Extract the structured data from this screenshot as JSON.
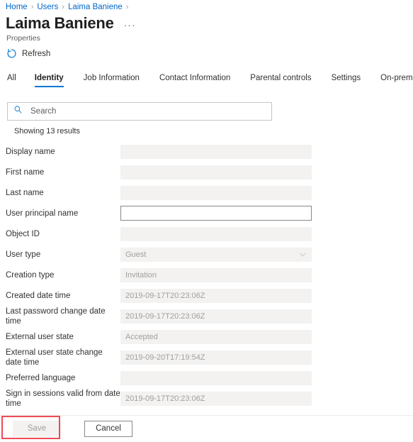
{
  "breadcrumb": {
    "items": [
      {
        "label": "Home"
      },
      {
        "label": "Users"
      },
      {
        "label": "Laima Baniene"
      }
    ],
    "separator": "›"
  },
  "header": {
    "title": "Laima Baniene",
    "subtitle": "Properties",
    "overflow_menu": "···"
  },
  "commandbar": {
    "refresh_label": "Refresh",
    "refresh_icon": "refresh-icon"
  },
  "tabs": [
    {
      "label": "All",
      "active": false
    },
    {
      "label": "Identity",
      "active": true
    },
    {
      "label": "Job Information",
      "active": false
    },
    {
      "label": "Contact Information",
      "active": false
    },
    {
      "label": "Parental controls",
      "active": false
    },
    {
      "label": "Settings",
      "active": false
    },
    {
      "label": "On-premises",
      "active": false
    }
  ],
  "search": {
    "placeholder": "Search",
    "value": "",
    "icon": "search-icon"
  },
  "results": {
    "count_text": "Showing 13 results"
  },
  "fields": [
    {
      "label": "Display name",
      "value": "",
      "state": "disabled",
      "type": "text"
    },
    {
      "label": "First name",
      "value": "",
      "state": "disabled",
      "type": "text"
    },
    {
      "label": "Last name",
      "value": "",
      "state": "disabled",
      "type": "text"
    },
    {
      "label": "User principal name",
      "value": "",
      "state": "editable",
      "type": "text"
    },
    {
      "label": "Object ID",
      "value": "",
      "state": "disabled",
      "type": "text",
      "redacted": true
    },
    {
      "label": "User type",
      "value": "Guest",
      "state": "disabled",
      "type": "select"
    },
    {
      "label": "Creation type",
      "value": "Invitation",
      "state": "disabled",
      "type": "text"
    },
    {
      "label": "Created date time",
      "value": "2019-09-17T20:23:06Z",
      "state": "disabled",
      "type": "text"
    },
    {
      "label": "Last password change date time",
      "value": "2019-09-17T20:23:06Z",
      "state": "disabled",
      "type": "text"
    },
    {
      "label": "External user state",
      "value": "Accepted",
      "state": "disabled",
      "type": "text"
    },
    {
      "label": "External user state change date time",
      "value": "2019-09-20T17:19:54Z",
      "state": "disabled",
      "type": "text"
    },
    {
      "label": "Preferred language",
      "value": "",
      "state": "disabled",
      "type": "text"
    },
    {
      "label": "Sign in sessions valid from date time",
      "value": "2019-09-17T20:23:06Z",
      "state": "disabled",
      "type": "text"
    }
  ],
  "footer": {
    "save_label": "Save",
    "save_disabled": true,
    "cancel_label": "Cancel"
  },
  "colors": {
    "accent": "#0078d4",
    "link": "#0066cc",
    "disabled_field_bg": "#f3f2f1",
    "highlight": "#ef4b55",
    "text": "#323130"
  }
}
